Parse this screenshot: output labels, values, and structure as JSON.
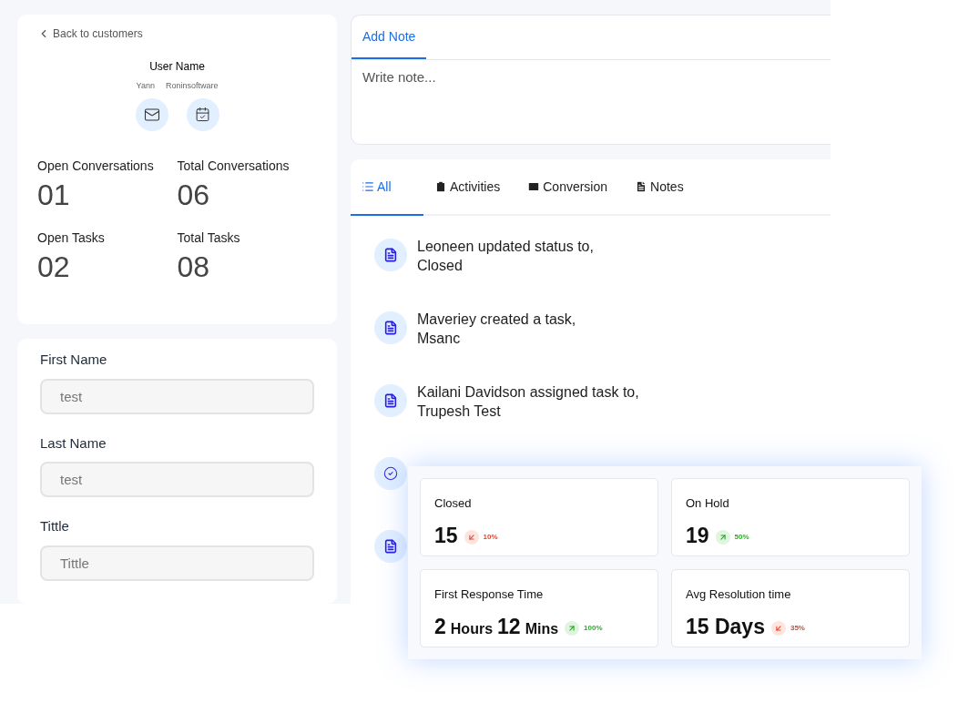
{
  "profile": {
    "back_link": "Back to customers",
    "name": "User Name",
    "first_name": "Yann",
    "company": "Roninsoftware",
    "stats": [
      {
        "label": "Open Conversations",
        "value": "01"
      },
      {
        "label": "Total Conversations",
        "value": "06"
      },
      {
        "label": "Open Tasks",
        "value": "02"
      },
      {
        "label": "Total Tasks",
        "value": "08"
      }
    ]
  },
  "form": {
    "fields": [
      {
        "label": "First Name",
        "value": "test"
      },
      {
        "label": "Last Name",
        "value": "test"
      },
      {
        "label": "Tittle",
        "placeholder": "Tittle"
      }
    ]
  },
  "note": {
    "tabs": [
      {
        "label": "Add Note",
        "selected": true
      }
    ],
    "placeholder": "Write note..."
  },
  "activity": {
    "tabs": [
      {
        "label": "All",
        "selected": true
      },
      {
        "label": "Activities",
        "selected": false
      },
      {
        "label": "Conversion",
        "selected": false
      },
      {
        "label": "Notes",
        "selected": false
      }
    ],
    "items": [
      {
        "kind": "document",
        "text": "Leoneen updated status to,",
        "detail": "Closed"
      },
      {
        "kind": "document",
        "text": "Maveriey created a task,",
        "detail": "Msanc"
      },
      {
        "kind": "document",
        "text": "Kailani Davidson assigned task to,",
        "detail": "Trupesh Test"
      },
      {
        "kind": "check"
      },
      {
        "kind": "document"
      }
    ]
  },
  "summary": {
    "cards": [
      {
        "label": "Closed",
        "value": [
          {
            "kind": "number",
            "text": "15"
          }
        ],
        "kind": "down",
        "change": "10%"
      },
      {
        "label": "On Hold",
        "value": [
          {
            "kind": "number",
            "text": "19"
          }
        ],
        "kind": "up",
        "change": "50%"
      },
      {
        "label": "First Response Time",
        "value": [
          {
            "kind": "number",
            "text": "2"
          },
          {
            "kind": "unit",
            "text": "Hours"
          },
          {
            "kind": "number",
            "text": "12"
          },
          {
            "kind": "unit",
            "text": "Mins"
          }
        ],
        "kind": "up",
        "change": "100%"
      },
      {
        "label": "Avg Resolution time",
        "value": [
          {
            "kind": "number",
            "text": "15 Days"
          }
        ],
        "kind": "down",
        "change": "35%"
      }
    ]
  }
}
